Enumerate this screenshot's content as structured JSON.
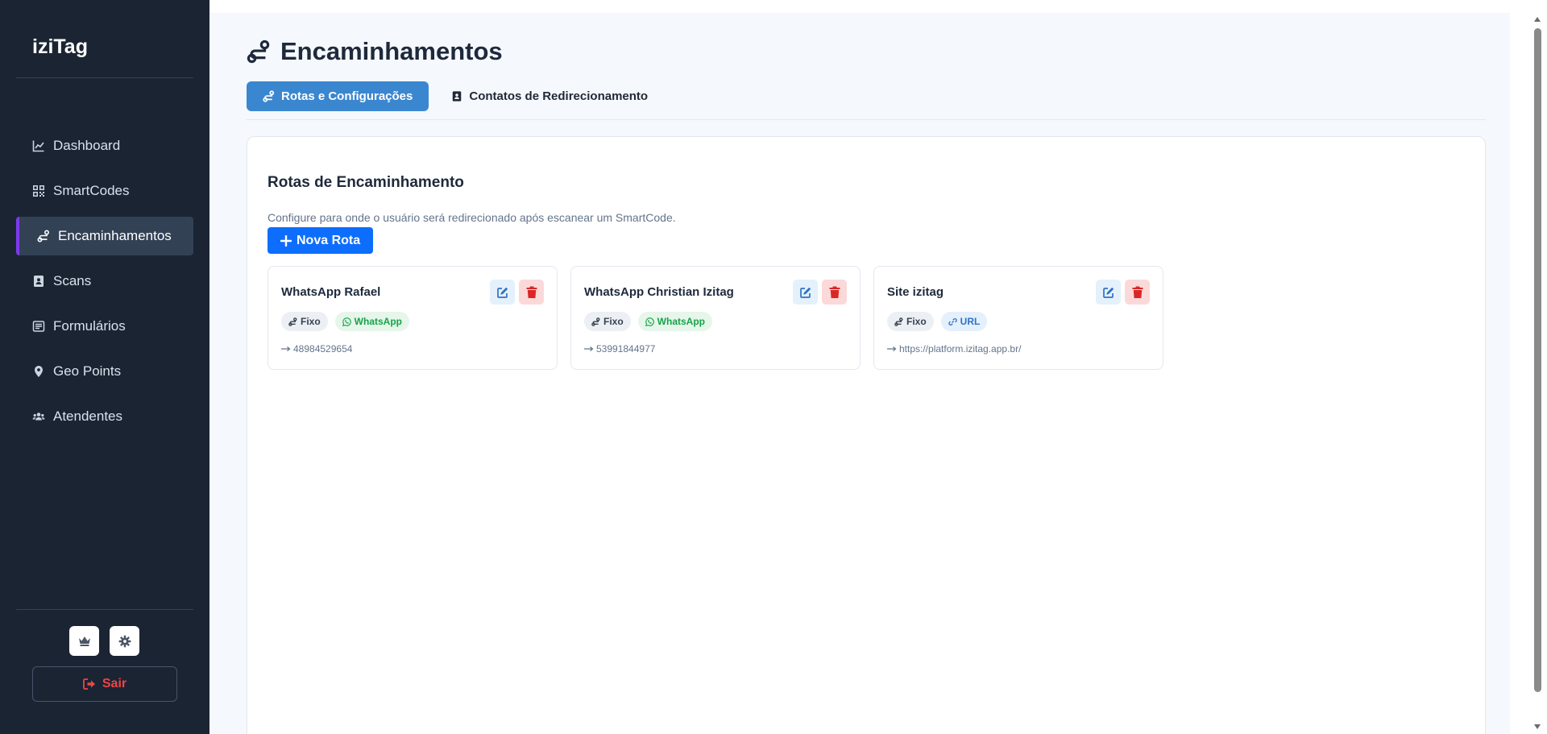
{
  "app": {
    "brand": "iziTag"
  },
  "sidebar": {
    "items": [
      {
        "label": "Dashboard",
        "icon": "chart-line-icon",
        "active": false
      },
      {
        "label": "SmartCodes",
        "icon": "qrcode-icon",
        "active": false
      },
      {
        "label": "Encaminhamentos",
        "icon": "route-icon",
        "active": true
      },
      {
        "label": "Scans",
        "icon": "address-book-icon",
        "active": false
      },
      {
        "label": "Formulários",
        "icon": "form-icon",
        "active": false
      },
      {
        "label": "Geo Points",
        "icon": "map-pin-icon",
        "active": false
      },
      {
        "label": "Atendentes",
        "icon": "users-icon",
        "active": false
      }
    ],
    "footer_buttons": [
      {
        "icon": "crown-icon"
      },
      {
        "icon": "gear-icon"
      }
    ],
    "logout_label": "Sair"
  },
  "header": {
    "title": "Encaminhamentos",
    "icon": "route-icon"
  },
  "tabs": [
    {
      "label": "Rotas e Configurações",
      "icon": "route-icon",
      "active": true
    },
    {
      "label": "Contatos de Redirecionamento",
      "icon": "address-book-icon",
      "active": false
    }
  ],
  "panel": {
    "title": "Rotas de Encaminhamento",
    "description": "Configure para onde o usuário será redirecionado após escanear um SmartCode.",
    "new_button_label": "Nova Rota"
  },
  "routes": [
    {
      "name": "WhatsApp Rafael",
      "mode": "Fixo",
      "type": "WhatsApp",
      "destination": "48984529654"
    },
    {
      "name": "WhatsApp Christian Izitag",
      "mode": "Fixo",
      "type": "WhatsApp",
      "destination": "53991844977"
    },
    {
      "name": "Site izitag",
      "mode": "Fixo",
      "type": "URL",
      "destination": "https://platform.izitag.app.br/"
    }
  ],
  "colors": {
    "sidebar_bg": "#1b2433",
    "active_accent": "#7c3aed",
    "primary": "#0d6efd",
    "tab_active": "#3a87d0",
    "danger": "#ef4444",
    "whatsapp": "#16a34a"
  }
}
